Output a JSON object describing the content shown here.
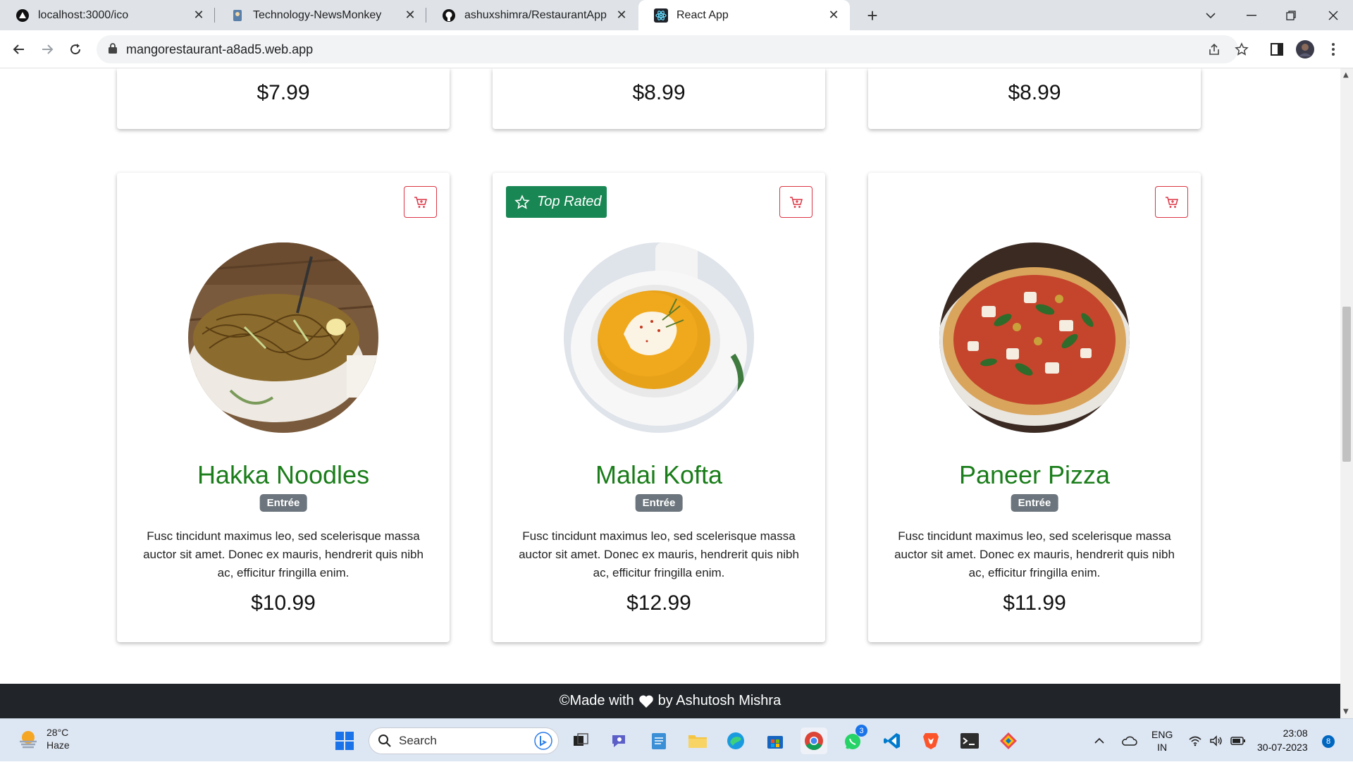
{
  "browser": {
    "tabs": [
      {
        "title": "localhost:3000/ico",
        "icon": "triangle-logo-icon",
        "active": false
      },
      {
        "title": "Technology-NewsMonkey",
        "icon": "newsmonkey-icon",
        "active": false
      },
      {
        "title": "ashuxshimra/RestaurantApp",
        "icon": "github-icon",
        "active": false
      },
      {
        "title": "React App",
        "icon": "react-icon",
        "active": true
      }
    ],
    "url": "mangorestaurant-a8ad5.web.app"
  },
  "top_cards": [
    {
      "price": "$7.99"
    },
    {
      "price": "$8.99"
    },
    {
      "price": "$8.99"
    }
  ],
  "cards": [
    {
      "title": "Hakka Noodles",
      "category": "Entrée",
      "description": "Fusc tincidunt maximus leo, sed scelerisque massa auctor sit amet. Donec ex mauris, hendrerit quis nibh ac, efficitur fringilla enim.",
      "price": "$10.99",
      "top_rated": false
    },
    {
      "title": "Malai Kofta",
      "category": "Entrée",
      "description": "Fusc tincidunt maximus leo, sed scelerisque massa auctor sit amet. Donec ex mauris, hendrerit quis nibh ac, efficitur fringilla enim.",
      "price": "$12.99",
      "top_rated": true,
      "badge_label": "Top Rated"
    },
    {
      "title": "Paneer Pizza",
      "category": "Entrée",
      "description": "Fusc tincidunt maximus leo, sed scelerisque massa auctor sit amet. Donec ex mauris, hendrerit quis nibh ac, efficitur fringilla enim.",
      "price": "$11.99",
      "top_rated": false
    }
  ],
  "footer": {
    "prefix": "©Made with",
    "suffix": "by Ashutosh Mishra"
  },
  "taskbar": {
    "weather_temp": "28°C",
    "weather_desc": "Haze",
    "search_label": "Search",
    "lang_top": "ENG",
    "lang_bottom": "IN",
    "time": "23:08",
    "date": "30-07-2023",
    "notifications": "8",
    "whatsapp_badge": "3"
  },
  "colors": {
    "title_green": "#1a7d1a",
    "top_rated_bg": "#198754",
    "cart_red": "#dc3545",
    "badge_gray": "#6c757d",
    "footer_bg": "#212529"
  }
}
